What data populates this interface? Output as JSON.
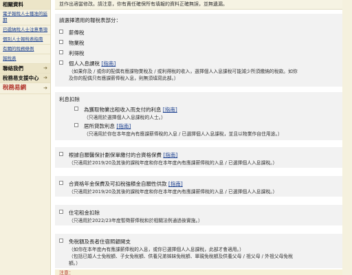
{
  "sidebar": {
    "section_title": "相關資料",
    "links": [
      "電子報稅人士獲准的延期",
      "已遞納稅人士注意事項",
      "個別人士報稅表指南",
      "有關的稅務條例",
      "報稅表"
    ],
    "contact": "聯絡我們",
    "support": "稅務易支援中心",
    "brand": "稅務易網"
  },
  "top_note": "並作出適當修改。請注意，你有責任確保所有填報的資料正確無誤，並無遺漏。",
  "form": {
    "choose_label": "請選擇適用的報稅表部分：",
    "tax_types": [
      "薪俸稅",
      "物業稅",
      "利得稅"
    ],
    "personal": {
      "title": "個人入息課稅",
      "link": "[指南]",
      "desc1": "（如果你及 / 或你的配偶有應課物業稅及 / 或利得稅的收入，選擇個人入息課稅可能減少所須繳納的稅款。如你",
      "desc2": "及你的配偶只有應課薪俸稅入息，則無須填寫此部。）"
    },
    "interest": {
      "title": "利息扣除",
      "items": [
        {
          "title": "為獲取物業出租收入而支付的利息",
          "link": "[指南]",
          "desc": "（只適用於選擇個人入息課稅的人士。）"
        },
        {
          "title": "居所貸款利息",
          "link": "[指南]",
          "desc": "（只適用於你在本年度內有應課薪俸稅的入息 / 已選擇個人入息課稅，並且以物業作自住用途。）"
        }
      ]
    },
    "vhis": {
      "title": "根據自願醫保計劃保單繳付的合資格保費",
      "link": "[指南]",
      "desc": "（只適用於2019/20及其後的課稅年度和你在本年度內有應課薪俸稅的入息 / 已選擇個人入息課稅。）"
    },
    "annuity": {
      "title": "合資格年金保費及可扣稅強積金自願性供款",
      "link": "[指南]",
      "desc": "（只適用於2019/20及其後的課稅年度和你在本年度內有應課薪俸稅的入息 / 已選擇個人入息課稅。）"
    },
    "rent": {
      "title": "住宅租金扣除",
      "desc": "（只適用於2022/23年度暫徵薪俸稅和於相關法例通過後實施。）"
    },
    "allowance": {
      "title": "免稅額及長者住宿照顧開支",
      "desc1": "（如你在本年度內有應課薪俸稅的入息，或你已選擇個人入息課稅，此部才會適用。）",
      "desc2": "（包括已婚人士免稅額、子女免稅額、供養兄弟姊妹免稅額、單親免稅額及供養父母 / 祖父母 / 外祖父母免稅",
      "desc3": "額。）"
    },
    "note_label": "注意："
  },
  "colors": {
    "sidebar_bg": "#f5f1de",
    "link": "#1a3f8f",
    "brand_red": "#b2362c",
    "section_bg": "#f2f2f2"
  }
}
